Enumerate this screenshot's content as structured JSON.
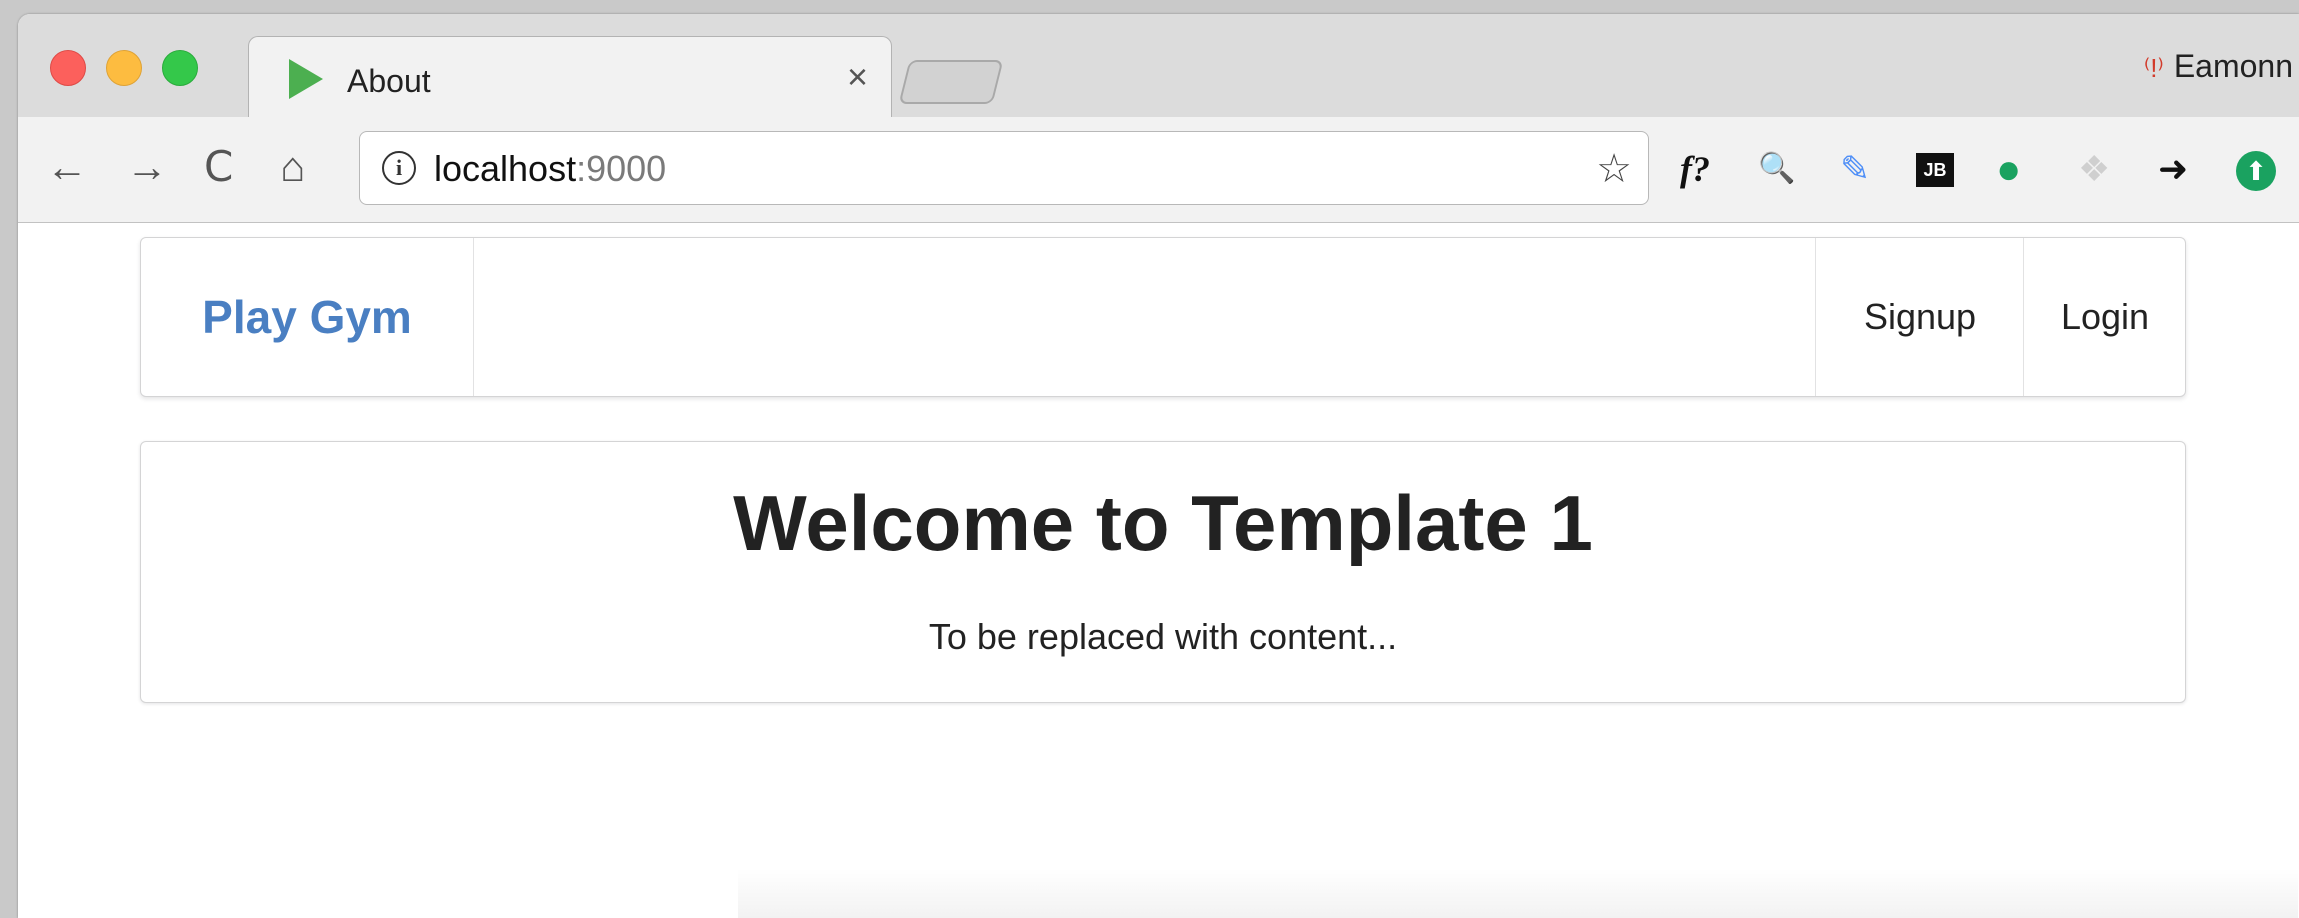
{
  "browser": {
    "tab_title": "About",
    "tab_close": "×",
    "profile_name": "Eamonn",
    "url_host": "localhost",
    "url_port": ":9000",
    "nav": {
      "back": "←",
      "forward": "→",
      "reload": "C",
      "home": "⌂"
    },
    "info_glyph": "i",
    "star_glyph": "☆",
    "extensions": [
      {
        "name": "f-question-extension",
        "glyph": "f?",
        "color": "#111111"
      },
      {
        "name": "magnifier-extension",
        "glyph": "🔍",
        "color": "#5a7fa8"
      },
      {
        "name": "eyedropper-extension",
        "glyph": "✎",
        "color": "#4f8ff7"
      },
      {
        "name": "jetbrains-extension",
        "glyph": "JB",
        "color": "#111111"
      },
      {
        "name": "chat-extension",
        "glyph": "●",
        "color": "#1aa260"
      },
      {
        "name": "dropbox-extension",
        "glyph": "❖",
        "color": "#cfcfcf"
      },
      {
        "name": "share-arrow-extension",
        "glyph": "➜",
        "color": "#111111"
      },
      {
        "name": "upload-extension",
        "glyph": "⬆",
        "color": "#1aa260"
      }
    ]
  },
  "navbar": {
    "brand": "Play Gym",
    "signup": "Signup",
    "login": "Login"
  },
  "main": {
    "heading": "Welcome to Template 1",
    "body": "To be replaced with content..."
  },
  "colors": {
    "brand": "#4a7fc2",
    "traffic_red": "#fc605c",
    "traffic_yellow": "#fdbc40",
    "traffic_green": "#34c84a"
  }
}
